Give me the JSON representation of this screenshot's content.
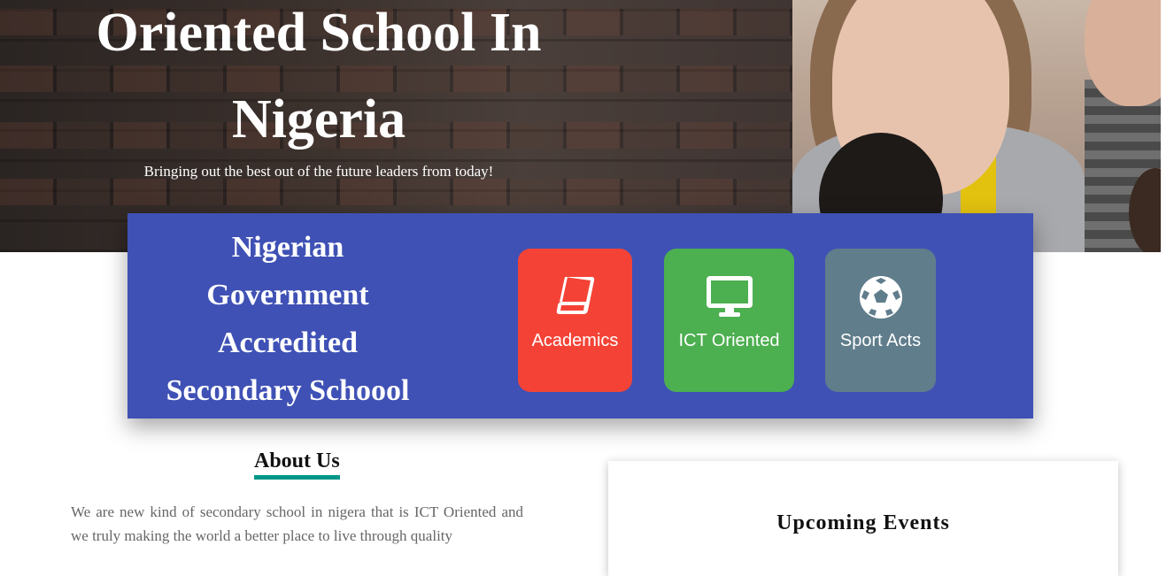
{
  "hero": {
    "title_line1": "Oriented School In",
    "title_line2": "Nigeria",
    "subtitle": "Bringing out the best out of the future leaders from today!"
  },
  "accreditation": {
    "lines": [
      "Nigerian",
      "Government",
      "Accredited",
      "Secondary Schoool"
    ]
  },
  "features": [
    {
      "label": "Academics",
      "icon": "book-icon",
      "color": "#f44336"
    },
    {
      "label": "ICT Oriented",
      "icon": "monitor-icon",
      "color": "#4caf50"
    },
    {
      "label": "Sport Acts",
      "icon": "soccer-ball-icon",
      "color": "#607d8b"
    }
  ],
  "about": {
    "title": "About Us",
    "text": "We are new kind of secondary school in nigera that is ICT Oriented and we truly making the world a better place to live through quality"
  },
  "events": {
    "title": "Upcoming Events"
  },
  "colors": {
    "panel": "#3f51b5",
    "accent_underline": "#009688"
  }
}
